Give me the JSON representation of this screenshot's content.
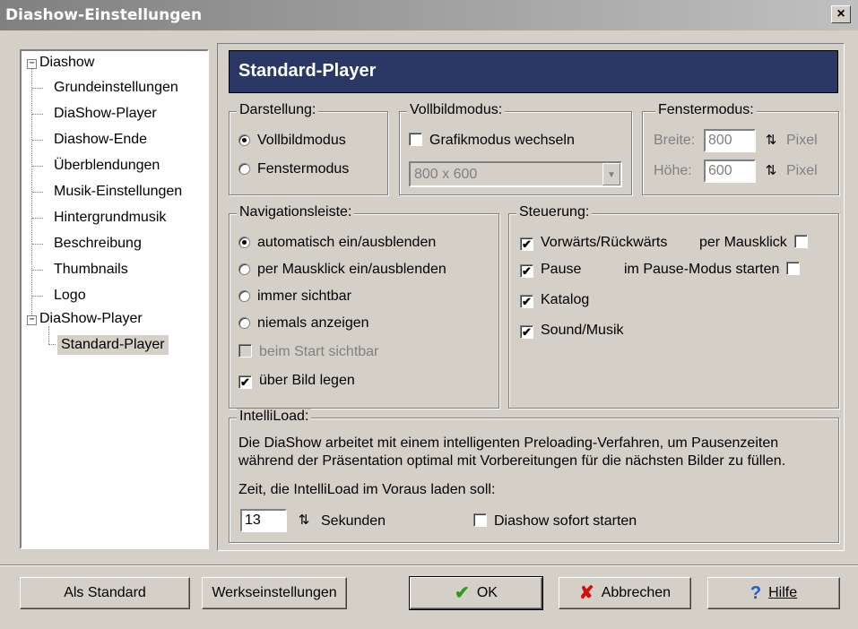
{
  "window": {
    "title": "Diashow-Einstellungen",
    "close_glyph": "×"
  },
  "tree": {
    "root1": "Diashow",
    "children1": [
      "Grundeinstellungen",
      "DiaShow-Player",
      "Diashow-Ende",
      "Überblendungen",
      "Musik-Einstellungen",
      "Hintergrundmusik",
      "Beschreibung",
      "Thumbnails",
      "Logo"
    ],
    "root2": "DiaShow-Player",
    "children2": [
      "Standard-Player"
    ],
    "expand_glyph": "−"
  },
  "header": {
    "title": "Standard-Player"
  },
  "darstellung": {
    "label": "Darstellung:",
    "opt1": "Vollbildmodus",
    "opt2": "Fenstermodus",
    "selected": "Vollbildmodus"
  },
  "vollbild": {
    "label": "Vollbildmodus:",
    "grafik_label": "Grafikmodus wechseln",
    "resolution": "800 x 600"
  },
  "fenster": {
    "label": "Fenstermodus:",
    "breite_label": "Breite:",
    "breite_value": "800",
    "hoehe_label": "Höhe:",
    "hoehe_value": "600",
    "unit": "Pixel"
  },
  "navigation": {
    "label": "Navigationsleiste:",
    "options": [
      "automatisch ein/ausblenden",
      "per Mausklick ein/ausblenden",
      "immer sichtbar",
      "niemals anzeigen"
    ],
    "start_visible": "beim Start sichtbar",
    "over_image": "über Bild legen"
  },
  "steuerung": {
    "label": "Steuerung:",
    "vorwaerts": "Vorwärts/Rückwärts",
    "mausklick": "per Mausklick",
    "pause": "Pause",
    "pause_start": "im Pause-Modus starten",
    "katalog": "Katalog",
    "sound": "Sound/Musik"
  },
  "intelliload": {
    "label": "IntelliLoad:",
    "desc1": "Die DiaShow arbeitet mit einem intelligenten Preloading-Verfahren, um Pausenzeiten",
    "desc2": "während der Präsentation optimal mit Vorbereitungen für die nächsten Bilder zu füllen.",
    "prompt": "Zeit, die IntelliLoad im Voraus laden soll:",
    "seconds_value": "13",
    "seconds_unit": "Sekunden",
    "start_now": "Diashow sofort starten"
  },
  "buttons": {
    "standard": "Als Standard",
    "werk": "Werkseinstellungen",
    "ok": "OK",
    "cancel": "Abbrechen",
    "help": "Hilfe"
  },
  "icons": {
    "check_mark": "✔",
    "cross": "✘",
    "question": "?",
    "combo_arrow": "▼",
    "spin": "⇅"
  },
  "colors": {
    "header_bg": "#2b3866",
    "ok_green": "#2e9a1e",
    "cancel_red": "#d01010",
    "help_blue": "#1a5fd0"
  }
}
